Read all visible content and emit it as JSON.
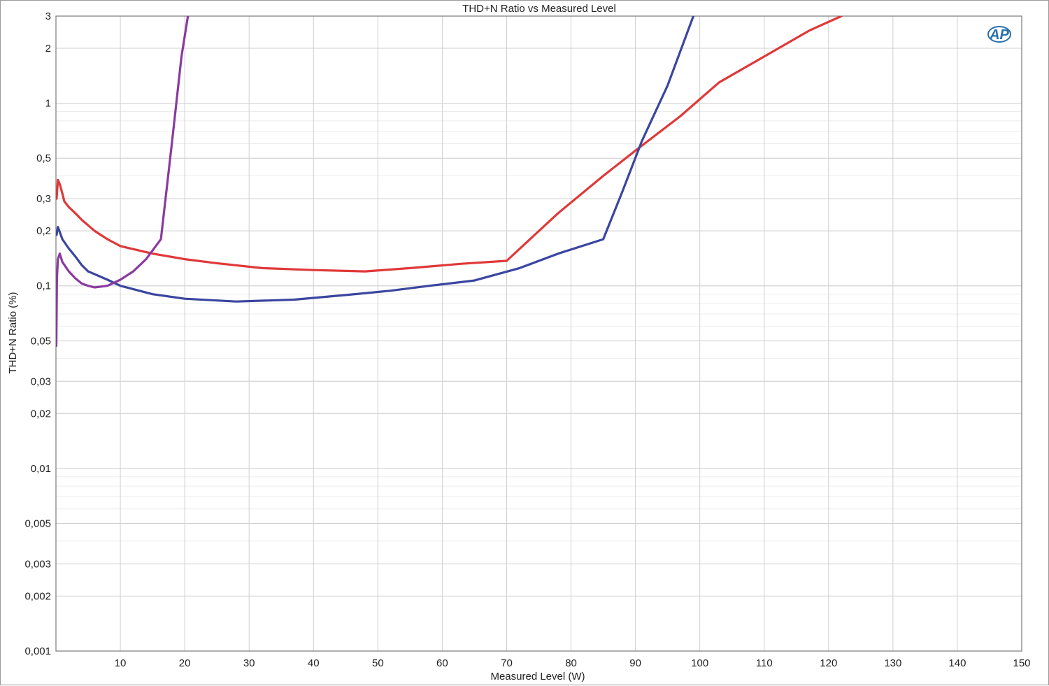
{
  "chart_data": {
    "type": "line",
    "title": "THD+N Ratio vs Measured Level",
    "xlabel": "Measured Level (W)",
    "ylabel": "THD+N Ratio (%)",
    "xlim": [
      0,
      150
    ],
    "ylim": [
      0.001,
      3
    ],
    "yscale": "log",
    "grid": true,
    "logo": "AP",
    "x_ticks": [
      10,
      20,
      30,
      40,
      50,
      60,
      70,
      80,
      90,
      100,
      110,
      120,
      130,
      140,
      150
    ],
    "y_ticks": [
      {
        "value": 3,
        "label": "3"
      },
      {
        "value": 2,
        "label": "2"
      },
      {
        "value": 1,
        "label": "1"
      },
      {
        "value": 0.5,
        "label": "0,5"
      },
      {
        "value": 0.3,
        "label": "0,3"
      },
      {
        "value": 0.2,
        "label": "0,2"
      },
      {
        "value": 0.1,
        "label": "0,1"
      },
      {
        "value": 0.05,
        "label": "0,05"
      },
      {
        "value": 0.03,
        "label": "0,03"
      },
      {
        "value": 0.02,
        "label": "0,02"
      },
      {
        "value": 0.01,
        "label": "0,01"
      },
      {
        "value": 0.005,
        "label": "0,005"
      },
      {
        "value": 0.003,
        "label": "0,003"
      },
      {
        "value": 0.002,
        "label": "0,002"
      },
      {
        "value": 0.001,
        "label": "0,001"
      }
    ],
    "series": [
      {
        "color": "#e03838",
        "points": [
          [
            0.1,
            0.3
          ],
          [
            0.3,
            0.38
          ],
          [
            0.6,
            0.36
          ],
          [
            1,
            0.32
          ],
          [
            1.3,
            0.29
          ],
          [
            2,
            0.27
          ],
          [
            3,
            0.25
          ],
          [
            4,
            0.23
          ],
          [
            6,
            0.2
          ],
          [
            8,
            0.18
          ],
          [
            10,
            0.165
          ],
          [
            15,
            0.15
          ],
          [
            20,
            0.14
          ],
          [
            25,
            0.133
          ],
          [
            32,
            0.125
          ],
          [
            40,
            0.122
          ],
          [
            48,
            0.12
          ],
          [
            55,
            0.125
          ],
          [
            63,
            0.132
          ],
          [
            70,
            0.137
          ],
          [
            78,
            0.25
          ],
          [
            85,
            0.4
          ],
          [
            90,
            0.55
          ],
          [
            97,
            0.85
          ],
          [
            103,
            1.3
          ],
          [
            110,
            1.8
          ],
          [
            117,
            2.5
          ],
          [
            122,
            3.0
          ]
        ]
      },
      {
        "color": "#3a46a0",
        "points": [
          [
            0.1,
            0.19
          ],
          [
            0.3,
            0.21
          ],
          [
            1,
            0.18
          ],
          [
            2,
            0.16
          ],
          [
            3,
            0.145
          ],
          [
            4,
            0.13
          ],
          [
            5,
            0.12
          ],
          [
            8,
            0.108
          ],
          [
            10,
            0.1
          ],
          [
            15,
            0.09
          ],
          [
            20,
            0.085
          ],
          [
            28,
            0.082
          ],
          [
            37,
            0.084
          ],
          [
            45,
            0.089
          ],
          [
            52,
            0.094
          ],
          [
            58,
            0.1
          ],
          [
            65,
            0.107
          ],
          [
            72,
            0.125
          ],
          [
            78,
            0.15
          ],
          [
            85,
            0.18
          ],
          [
            88,
            0.33
          ],
          [
            91,
            0.62
          ],
          [
            95,
            1.25
          ],
          [
            99,
            3.0
          ]
        ]
      },
      {
        "color": "#8a3aa0",
        "points": [
          [
            0.05,
            0.047
          ],
          [
            0.15,
            0.11
          ],
          [
            0.3,
            0.14
          ],
          [
            0.6,
            0.15
          ],
          [
            1,
            0.135
          ],
          [
            2,
            0.12
          ],
          [
            3,
            0.11
          ],
          [
            4,
            0.103
          ],
          [
            5,
            0.1
          ],
          [
            6,
            0.098
          ],
          [
            8,
            0.1
          ],
          [
            10,
            0.108
          ],
          [
            12,
            0.12
          ],
          [
            14,
            0.14
          ],
          [
            16.3,
            0.18
          ],
          [
            18,
            0.6
          ],
          [
            19.5,
            1.8
          ],
          [
            20.5,
            3.0
          ]
        ]
      }
    ]
  }
}
